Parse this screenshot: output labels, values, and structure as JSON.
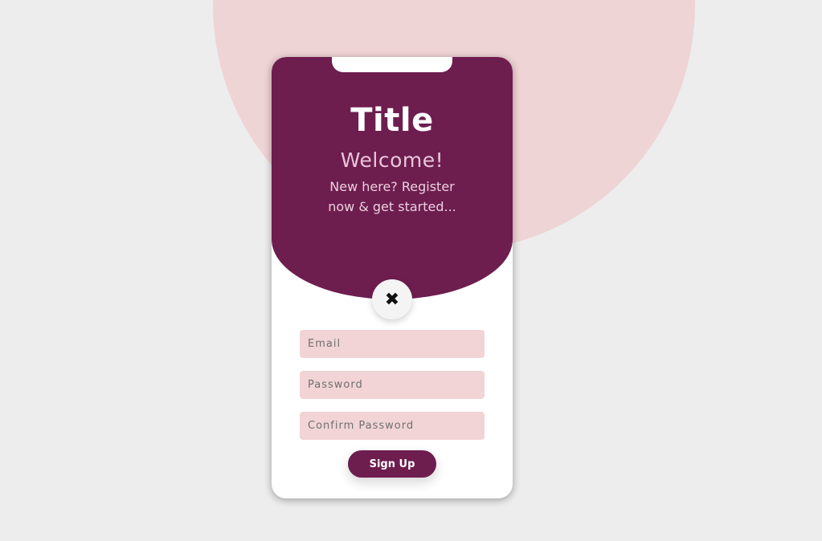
{
  "colors": {
    "page_background": "#ededed",
    "circle": "#efd4d5",
    "primary": "#6e1d4f",
    "input_background": "#f2d4d6"
  },
  "header": {
    "title": "Title",
    "welcome": "Welcome!",
    "subtitle": "New here? Register now & get started..."
  },
  "close_button": {
    "icon": "close-icon",
    "glyph": "✖"
  },
  "form": {
    "email_placeholder": "Email",
    "password_placeholder": "Password",
    "confirm_password_placeholder": "Confirm Password",
    "signup_label": "Sign Up"
  }
}
